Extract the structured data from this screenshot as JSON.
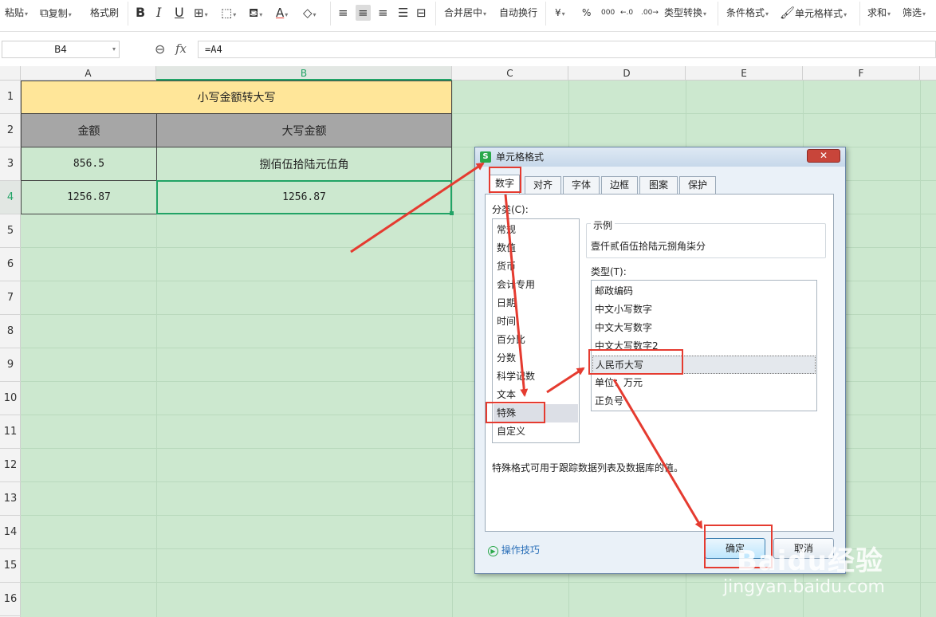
{
  "toolbar": {
    "paste": "粘贴",
    "copy": "复制",
    "format_painter": "格式刷",
    "bold": "B",
    "italic": "I",
    "underline": "U",
    "font_color": "A",
    "merge_center": "合并居中",
    "wrap_text": "自动换行",
    "currency": "¥",
    "percent": "%",
    "thousands": "000",
    "inc_decimal": "←.0",
    "dec_decimal": ".00→",
    "type_convert": "类型转换",
    "cond_format": "条件格式",
    "cell_style": "单元格样式",
    "sum": "求和",
    "filter": "筛选"
  },
  "formula_bar": {
    "name_box": "B4",
    "fx": "fx",
    "formula": "=A4"
  },
  "columns": [
    "A",
    "B",
    "C",
    "D",
    "E",
    "F"
  ],
  "rows": [
    "1",
    "2",
    "3",
    "4",
    "5",
    "6",
    "7",
    "8",
    "9",
    "10",
    "11",
    "12",
    "13",
    "14",
    "15",
    "16"
  ],
  "table": {
    "title": "小写金额转大写",
    "header_amount": "金额",
    "header_upper": "大写金额",
    "r3_amount": "856.5",
    "r3_upper": "捌佰伍拾陆元伍角",
    "r4_amount": "1256.87",
    "r4_upper": "1256.87"
  },
  "dialog": {
    "title": "单元格格式",
    "close": "✕",
    "tabs": [
      "数字",
      "对齐",
      "字体",
      "边框",
      "图案",
      "保护"
    ],
    "category_label": "分类(C):",
    "categories": [
      "常规",
      "数值",
      "货币",
      "会计专用",
      "日期",
      "时间",
      "百分比",
      "分数",
      "科学记数",
      "文本",
      "特殊",
      "自定义"
    ],
    "selected_category": "特殊",
    "sample_label": "示例",
    "sample_value": "壹仟贰佰伍拾陆元捌角柒分",
    "type_label": "类型(T):",
    "types": [
      "邮政编码",
      "中文小写数字",
      "中文大写数字",
      "中文大写数字2",
      "人民币大写",
      "单位：万元",
      "正负号"
    ],
    "selected_type": "人民币大写",
    "description": "特殊格式可用于跟踪数据列表及数据库的值。",
    "tips": "操作技巧",
    "ok": "确定",
    "cancel": "取消"
  },
  "watermark": {
    "brand": "Baidu经验",
    "url": "jingyan.baidu.com"
  },
  "colors": {
    "sheet_bg": "#cce8cf",
    "title_fill": "#ffe699",
    "header_fill": "#a6a6a6",
    "selection": "#21a366",
    "annotation": "#e53b30"
  }
}
